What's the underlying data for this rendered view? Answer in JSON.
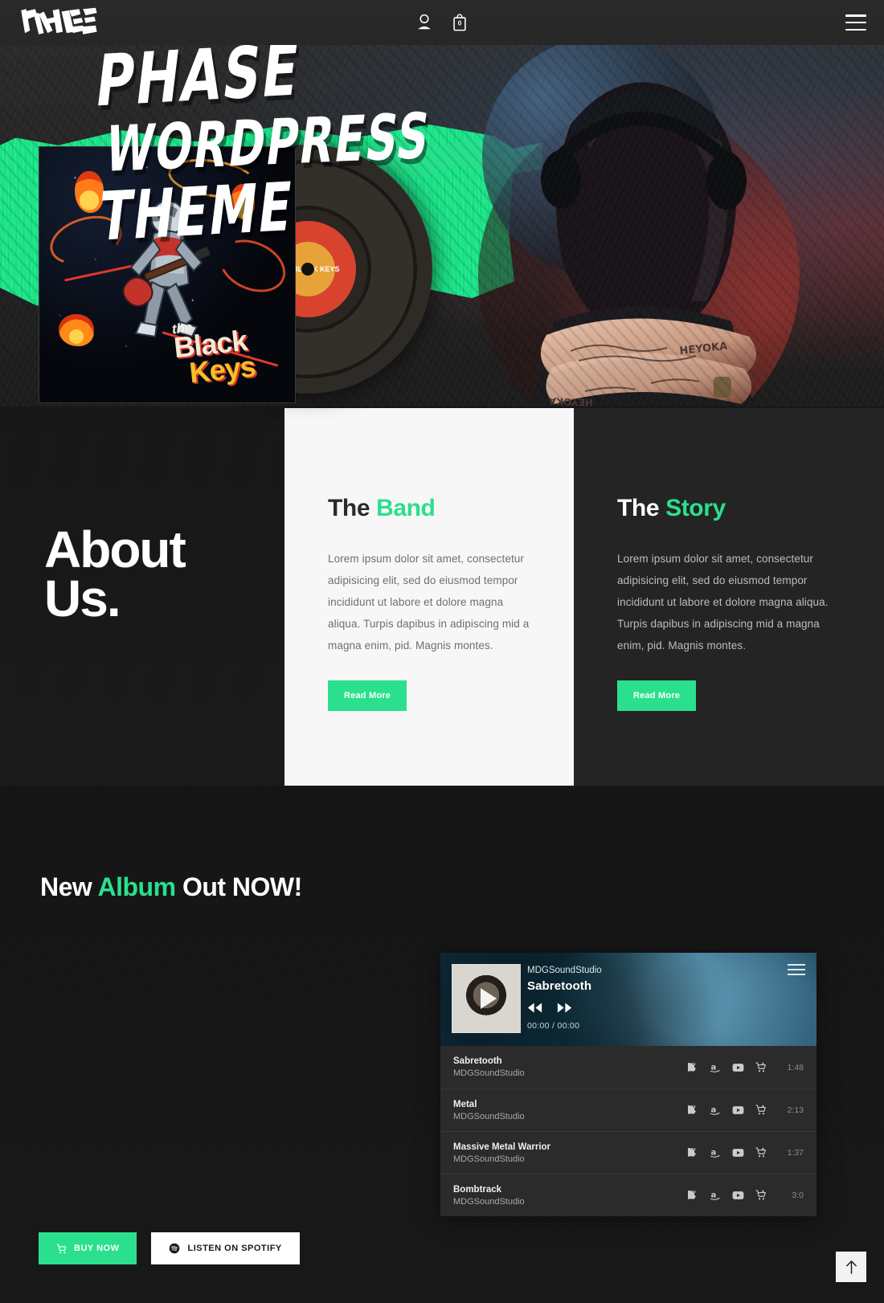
{
  "header": {
    "logo_text": "PHASE",
    "account_icon": "person-icon",
    "cart_icon": "shopping-bag-icon",
    "cart_count": "0",
    "menu_icon": "hamburger-menu-icon"
  },
  "hero": {
    "line1": "PHASE",
    "line2": "WORDPRESS",
    "line3": "THEME"
  },
  "about": {
    "title_line1": "About",
    "title_line2": "Us.",
    "cards": [
      {
        "heading_plain": "The ",
        "heading_accent": "Band",
        "body": "Lorem ipsum dolor sit amet, consectetur adipisicing elit, sed do eiusmod tempor incididunt ut labore et dolore magna aliqua. Turpis dapibus in adipiscing mid a magna enim, pid. Magnis montes.",
        "button": "Read More"
      },
      {
        "heading_plain": "The ",
        "heading_accent": "Story",
        "body": "Lorem ipsum dolor sit amet, consectetur adipisicing elit, sed do eiusmod tempor incididunt ut labore et dolore magna aliqua. Turpis dapibus in adipiscing mid a magna enim, pid. Magnis montes.",
        "button": "Read More"
      }
    ]
  },
  "album": {
    "title_a": "New ",
    "title_accent": "Album",
    "title_b": " Out NOW!",
    "cover": {
      "the": "the",
      "black": "Black",
      "keys": "Keys"
    },
    "vinyl_label": "THE BLACK KEYS",
    "buy_button": "BUY NOW",
    "buy_icon": "shopping-cart-icon",
    "spotify_button": "LISTEN ON SPOTIFY",
    "spotify_icon": "spotify-icon"
  },
  "player": {
    "now_playing": {
      "artist": "MDGSoundStudio",
      "title": "Sabretooth",
      "time": "00:00 / 00:00",
      "play_icon": "play-icon",
      "prev_icon": "skip-previous-icon",
      "next_icon": "skip-next-icon",
      "menu_icon": "playlist-menu-icon"
    },
    "store_icons": [
      "apple-icon",
      "amazon-icon",
      "youtube-icon",
      "cart-icon"
    ],
    "tracks": [
      {
        "title": "Sabretooth",
        "artist": "MDGSoundStudio",
        "duration": "1:48"
      },
      {
        "title": "Metal",
        "artist": "MDGSoundStudio",
        "duration": "2:13"
      },
      {
        "title": "Massive Metal Warrior",
        "artist": "MDGSoundStudio",
        "duration": "1:37"
      },
      {
        "title": "Bombtrack",
        "artist": "MDGSoundStudio",
        "duration": "3:0"
      }
    ]
  },
  "scroll_top": {
    "icon": "arrow-up-icon"
  },
  "colors": {
    "accent_green": "#2ae08c",
    "dark_bg": "#1e1e1e",
    "card_light": "#f7f7f7",
    "card_dark": "#242424"
  }
}
